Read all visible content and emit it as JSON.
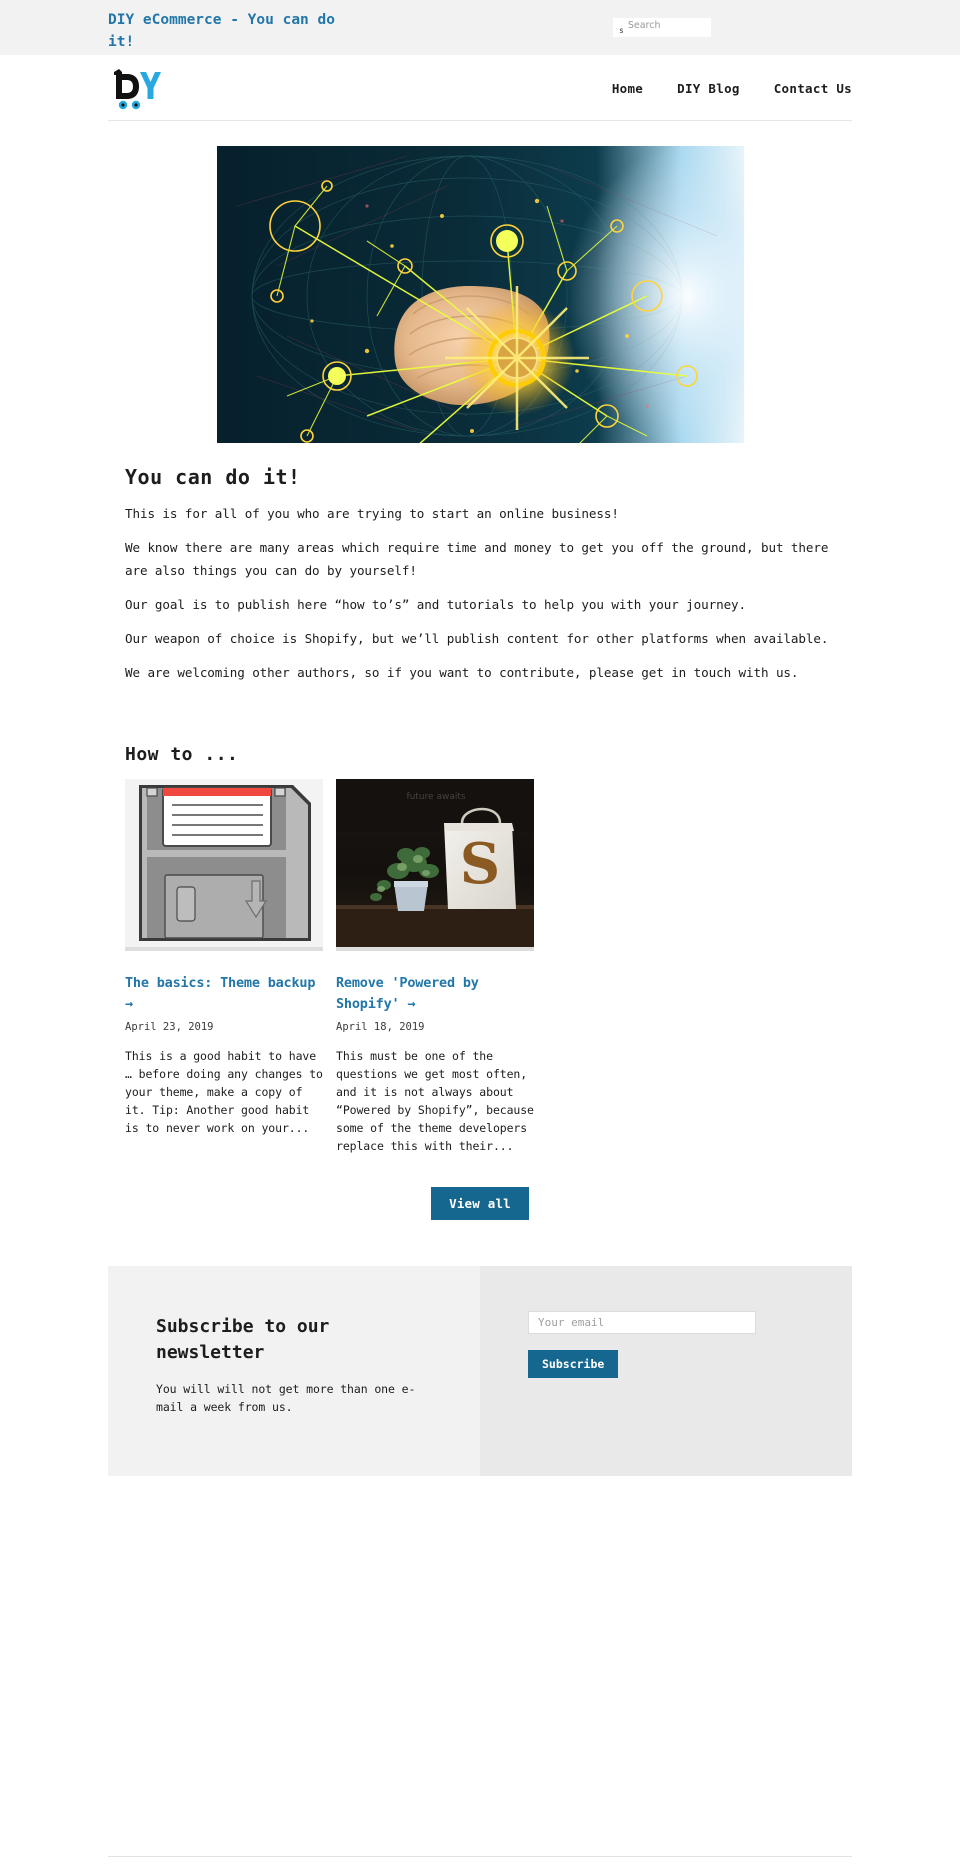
{
  "announcement": {
    "title": "DIY eCommerce - You can do it!",
    "search": {
      "icon": "search-icon",
      "icon_text": "s",
      "placeholder": "Search",
      "value": ""
    }
  },
  "header": {
    "logo_alt": "DIY cart logo",
    "nav": [
      {
        "label": "Home"
      },
      {
        "label": "DIY Blog"
      },
      {
        "label": "Contact Us"
      }
    ]
  },
  "hero": {
    "alt": "Fist punching through glowing yellow network nodes"
  },
  "intro": {
    "title": "You can do it!",
    "paragraphs": [
      "This is for all of you who are trying to start an online business!",
      "We know there are many areas which require time and money to get you off the ground, but there are also things you can do by yourself!",
      "Our goal is to publish here “how to’s” and tutorials to help you with your journey.",
      "Our weapon of choice is Shopify, but we’ll publish content for other platforms when available.",
      "We are welcoming other authors, so if you want to contribute, please get in touch with us."
    ]
  },
  "howto": {
    "title": "How to ...",
    "posts": [
      {
        "thumb": "floppy-disk-illustration",
        "title": "The basics: Theme backup →",
        "date": "April 23, 2019",
        "excerpt": "This is a good habit to have … before doing any changes to your theme, make a copy of it. Tip: Another good habit is to never work on your..."
      },
      {
        "thumb": "shopify-bag-photo",
        "title": "Remove 'Powered by Shopify' →",
        "date": "April 18, 2019",
        "excerpt": "This must be one of the questions we get most often, and it is not always about “Powered by Shopify”, because some of the theme developers replace this with their..."
      }
    ],
    "view_all_label": "View all"
  },
  "newsletter": {
    "heading": "Subscribe to our newsletter",
    "subtext": "You will will not get more than one e-mail a week from us.",
    "email_placeholder": "Your email",
    "email_value": "",
    "subscribe_label": "Subscribe"
  },
  "colors": {
    "accent_blue": "#2276a8",
    "button_blue": "#16678f",
    "bar_gray": "#f2f2f2",
    "panel_gray": "#e9e9e9"
  }
}
